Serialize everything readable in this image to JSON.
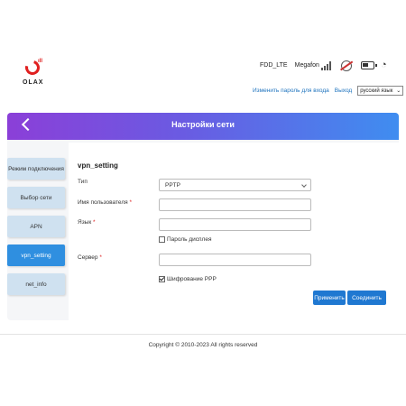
{
  "header": {
    "logo_text": "OLAX",
    "network_type": "FDD_LTE",
    "operator": "Megafon",
    "icons": [
      "signal-icon",
      "globe-icon",
      "battery-icon",
      "wifi-icon"
    ]
  },
  "toplinks": {
    "change_password": "Изменить пароль для входа",
    "logout": "Выход",
    "language": "русский язык"
  },
  "banner": {
    "title": "Настройки сети"
  },
  "sidebar": {
    "items": [
      {
        "label": "Режим подключения",
        "active": false
      },
      {
        "label": "Выбор сети",
        "active": false
      },
      {
        "label": "APN",
        "active": false
      },
      {
        "label": "vpn_setting",
        "active": true
      },
      {
        "label": "net_info",
        "active": false
      }
    ]
  },
  "form": {
    "title": "vpn_setting",
    "type_label": "Тип",
    "type_value": "PPTP",
    "username_label": "Имя пользователя",
    "username_value": "",
    "password_label": "Язык",
    "password_value": "",
    "show_password_label": "Пароль дисплея",
    "show_password_checked": false,
    "server_label": "Сервер",
    "server_value": "",
    "encryption_label": "Шифрование PPP",
    "encryption_checked": true,
    "required_mark": "*",
    "apply_button": "Применить",
    "connect_button": "Соединить"
  },
  "footer": {
    "copyright": "Copyright © 2010-2023 All rights reserved"
  },
  "colors": {
    "accent": "#1f78d1",
    "nav_active": "#2f8fe0",
    "nav_idle": "#cfe1f0",
    "banner_start": "#8b3fd8",
    "banner_end": "#3f8df0"
  }
}
